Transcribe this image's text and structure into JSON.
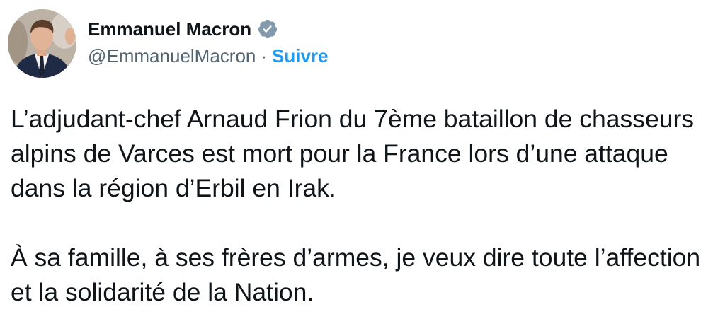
{
  "tweet": {
    "author": {
      "display_name": "Emmanuel Macron",
      "handle": "@EmmanuelMacron",
      "separator": "·",
      "follow_label": "Suivre",
      "verified_icon": "verified-badge-icon",
      "avatar": "avatar"
    },
    "paragraphs": [
      "L’adjudant-chef Arnaud Frion du 7ème bataillon de chasseurs alpins de Varces est mort pour la France lors d’une attaque dans la région d’Erbil en Irak.",
      "À sa famille, à ses frères d’armes, je veux dire toute l’affection et la solidarité de la Nation."
    ]
  },
  "colors": {
    "text": "#0f1419",
    "secondary": "#536471",
    "accent": "#1d9bf0",
    "badge": "#829aab"
  }
}
